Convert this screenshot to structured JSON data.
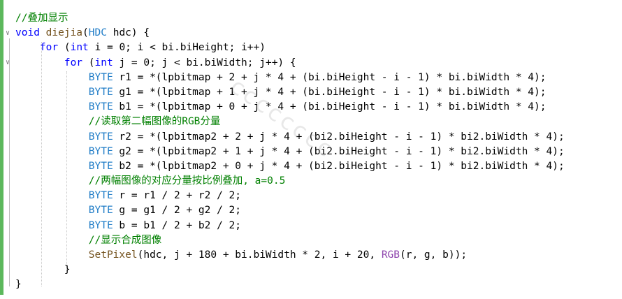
{
  "editor": {
    "fold_open_glyph": "∨",
    "lines": [
      [
        {
          "t": "//叠加显示",
          "c": "cm"
        }
      ],
      [
        {
          "t": "void",
          "c": "kw"
        },
        {
          "t": " ",
          "c": "tx"
        },
        {
          "t": "diejia",
          "c": "fn"
        },
        {
          "t": "(",
          "c": "tx"
        },
        {
          "t": "HDC",
          "c": "ty"
        },
        {
          "t": " hdc) {",
          "c": "tx"
        }
      ],
      [
        {
          "t": "    ",
          "c": "tx"
        },
        {
          "t": "for",
          "c": "kw"
        },
        {
          "t": " (",
          "c": "tx"
        },
        {
          "t": "int",
          "c": "kw"
        },
        {
          "t": " i = 0; i < bi.biHeight; i++)",
          "c": "tx"
        }
      ],
      [
        {
          "t": "        ",
          "c": "tx"
        },
        {
          "t": "for",
          "c": "kw"
        },
        {
          "t": " (",
          "c": "tx"
        },
        {
          "t": "int",
          "c": "kw"
        },
        {
          "t": " j = 0; j < bi.biWidth; j++) {",
          "c": "tx"
        }
      ],
      [
        {
          "t": "            ",
          "c": "tx"
        },
        {
          "t": "BYTE",
          "c": "ty"
        },
        {
          "t": " r1 = *(lpbitmap + 2 + j * 4 + (bi.biHeight - i - 1) * bi.biWidth * 4);",
          "c": "tx"
        }
      ],
      [
        {
          "t": "            ",
          "c": "tx"
        },
        {
          "t": "BYTE",
          "c": "ty"
        },
        {
          "t": " g1 = *(lpbitmap + 1 + j * 4 + (bi.biHeight - i - 1) * bi.biWidth * 4);",
          "c": "tx"
        }
      ],
      [
        {
          "t": "            ",
          "c": "tx"
        },
        {
          "t": "BYTE",
          "c": "ty"
        },
        {
          "t": " b1 = *(lpbitmap + 0 + j * 4 + (bi.biHeight - i - 1) * bi.biWidth * 4);",
          "c": "tx"
        }
      ],
      [
        {
          "t": "            ",
          "c": "tx"
        },
        {
          "t": "//读取第二幅图像的RGB分量",
          "c": "cm"
        }
      ],
      [
        {
          "t": "            ",
          "c": "tx"
        },
        {
          "t": "BYTE",
          "c": "ty"
        },
        {
          "t": " r2 = *(lpbitmap2 + 2 + j * 4 + (bi2.biHeight - i - 1) * bi2.biWidth * 4);",
          "c": "tx"
        }
      ],
      [
        {
          "t": "            ",
          "c": "tx"
        },
        {
          "t": "BYTE",
          "c": "ty"
        },
        {
          "t": " g2 = *(lpbitmap2 + 1 + j * 4 + (bi2.biHeight - i - 1) * bi2.biWidth * 4);",
          "c": "tx"
        }
      ],
      [
        {
          "t": "            ",
          "c": "tx"
        },
        {
          "t": "BYTE",
          "c": "ty"
        },
        {
          "t": " b2 = *(lpbitmap2 + 0 + j * 4 + (bi2.biHeight - i - 1) * bi2.biWidth * 4);",
          "c": "tx"
        }
      ],
      [
        {
          "t": "            ",
          "c": "tx"
        },
        {
          "t": "//两幅图像的对应分量按比例叠加, a=0.5",
          "c": "cm"
        }
      ],
      [
        {
          "t": "            ",
          "c": "tx"
        },
        {
          "t": "BYTE",
          "c": "ty"
        },
        {
          "t": " r = r1 / 2 + r2 / 2;",
          "c": "tx"
        }
      ],
      [
        {
          "t": "            ",
          "c": "tx"
        },
        {
          "t": "BYTE",
          "c": "ty"
        },
        {
          "t": " g = g1 / 2 + g2 / 2;",
          "c": "tx"
        }
      ],
      [
        {
          "t": "            ",
          "c": "tx"
        },
        {
          "t": "BYTE",
          "c": "ty"
        },
        {
          "t": " b = b1 / 2 + b2 / 2;",
          "c": "tx"
        }
      ],
      [
        {
          "t": "            ",
          "c": "tx"
        },
        {
          "t": "//显示合成图像",
          "c": "cm"
        }
      ],
      [
        {
          "t": "            ",
          "c": "tx"
        },
        {
          "t": "SetPixel",
          "c": "fn"
        },
        {
          "t": "(hdc, j + 180 + bi.biWidth * 2, i + 20, ",
          "c": "tx"
        },
        {
          "t": "RGB",
          "c": "mac"
        },
        {
          "t": "(r, g, b));",
          "c": "tx"
        }
      ],
      [
        {
          "t": "        }",
          "c": "tx"
        }
      ],
      [
        {
          "t": "}",
          "c": "tx"
        }
      ]
    ]
  },
  "colors": {
    "keyword": "#0000ff",
    "type": "#1f7cc7",
    "function": "#74531f",
    "macro": "#8e44ad",
    "comment": "#008000",
    "change_bar": "#5cb85c"
  }
}
